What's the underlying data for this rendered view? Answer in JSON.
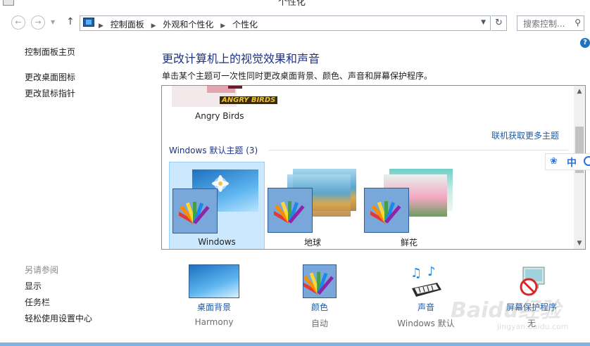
{
  "window": {
    "title": "个性化"
  },
  "nav": {
    "back_icon": "back-arrow-icon",
    "forward_icon": "forward-arrow-icon",
    "breadcrumbs": [
      "控制面板",
      "外观和个性化",
      "个性化"
    ],
    "search_placeholder": "搜索控制..."
  },
  "help": {
    "label": "?"
  },
  "leftnav": {
    "items": [
      "控制面板主页",
      "更改桌面图标",
      "更改鼠标指针"
    ],
    "see_also_title": "另请参阅",
    "see_also": [
      "显示",
      "任务栏",
      "轻松使用设置中心"
    ]
  },
  "main": {
    "title": "更改计算机上的视觉效果和声音",
    "subtitle": "单击某个主题可一次性同时更改桌面背景、颜色、声音和屏幕保护程序。",
    "get_more_online": "联机获取更多主题",
    "installed_theme": {
      "name": "Angry Birds",
      "logo_text": "ANGRY BIRDS"
    },
    "default_group": "Windows 默认主题 (3)",
    "themes": [
      {
        "name": "Windows",
        "selected": true
      },
      {
        "name": "地球",
        "selected": false
      },
      {
        "name": "鲜花",
        "selected": false
      }
    ]
  },
  "ime": {
    "lang": "中"
  },
  "bottom": {
    "items": [
      {
        "label": "桌面背景",
        "value": "Harmony"
      },
      {
        "label": "颜色",
        "value": "自动"
      },
      {
        "label": "声音",
        "value": "Windows 默认"
      },
      {
        "label": "屏幕保护程序",
        "value": "无"
      }
    ]
  },
  "watermark": {
    "brand": "Baidu经验",
    "url": "jingyan.baidu.com"
  },
  "colors": {
    "link": "#1e5aa8",
    "heading": "#1e3287",
    "selected_bg": "#cce8ff"
  }
}
